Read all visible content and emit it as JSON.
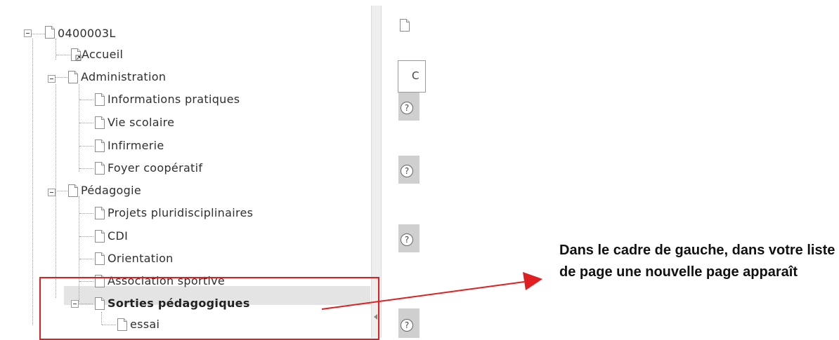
{
  "tree": {
    "root": "0400003L",
    "items": [
      {
        "label": "Accueil"
      },
      {
        "label": "Administration"
      },
      {
        "label": "Informations pratiques"
      },
      {
        "label": "Vie scolaire"
      },
      {
        "label": "Infirmerie"
      },
      {
        "label": "Foyer coopératif"
      },
      {
        "label": "Pédagogie"
      },
      {
        "label": "Projets pluridisciplinaires"
      },
      {
        "label": "CDI"
      },
      {
        "label": "Orientation"
      },
      {
        "label": "Association sportive"
      },
      {
        "label": "Sorties pédagogiques"
      },
      {
        "label": "essai"
      }
    ]
  },
  "right_panel": {
    "tab_letter": "C",
    "help_symbol": "?"
  },
  "annotation": {
    "text": "Dans le cadre de gauche, dans votre liste de page une nouvelle page apparaît",
    "color": "#e02020"
  },
  "icons": {
    "page": "page-icon",
    "shortcut": "shortcut-page-icon",
    "toggle": "collapse-toggle-icon"
  }
}
